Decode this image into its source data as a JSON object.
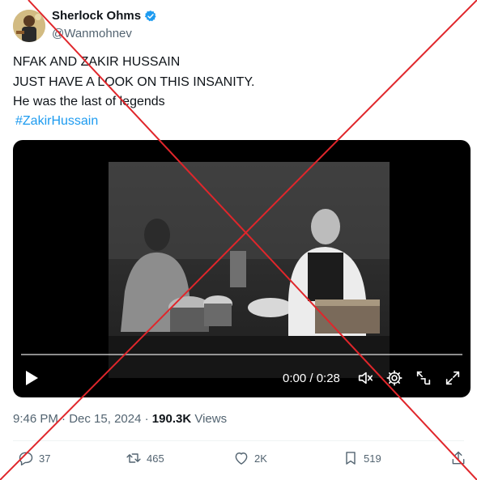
{
  "author": {
    "name": "Sherlock Ohms",
    "handle": "@Wanmohnev",
    "verified": true,
    "avatar_icon": "avatar-image"
  },
  "tweet": {
    "lines": [
      "NFAK AND ZAKIR HUSSAIN",
      "JUST HAVE A LOOK ON THIS INSANITY.",
      "He was the last of legends"
    ],
    "hashtag": "#ZakirHussain"
  },
  "video": {
    "time": "0:00 / 0:28",
    "progress": 0.0,
    "controls": [
      "play-icon",
      "volume-icon",
      "settings-icon",
      "pip-icon",
      "fullscreen-icon"
    ]
  },
  "meta": {
    "time": "9:46 PM",
    "sep1": "·",
    "date": "Dec 15, 2024",
    "sep2": "·",
    "views_count": "190.3K",
    "views_label": "Views"
  },
  "actions": {
    "replies": "37",
    "reposts": "465",
    "likes": "2K",
    "bookmarks": "519"
  },
  "colors": {
    "accent": "#1d9bf0",
    "cross": "#e0262b",
    "muted": "#536471"
  }
}
